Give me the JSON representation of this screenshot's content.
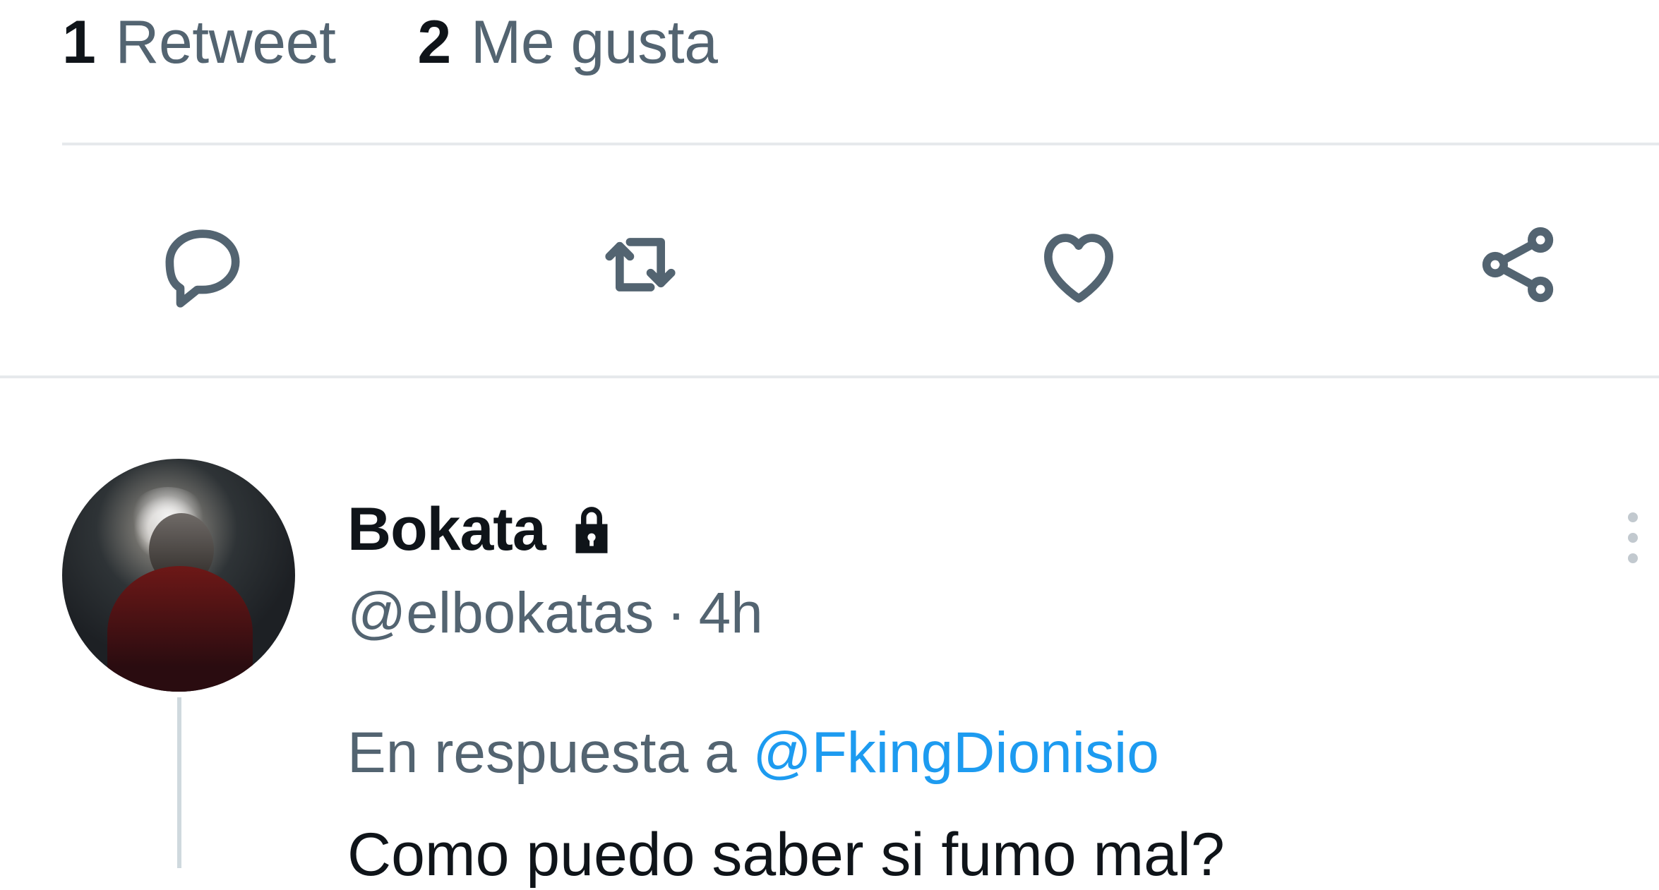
{
  "stats": {
    "retweets": {
      "count": "1",
      "label": "Retweet"
    },
    "likes": {
      "count": "2",
      "label": "Me gusta"
    }
  },
  "actions": [
    {
      "name": "reply",
      "icon": "reply-icon"
    },
    {
      "name": "retweet",
      "icon": "retweet-icon"
    },
    {
      "name": "like",
      "icon": "heart-icon"
    },
    {
      "name": "share",
      "icon": "share-icon"
    }
  ],
  "reply_tweet": {
    "display_name": "Bokata",
    "handle": "@elbokatas",
    "separator": "·",
    "time": "4h",
    "in_reply_to_prefix": "En respuesta a",
    "in_reply_to_handle": "@FkingDionisio",
    "text": "Como puedo saber si fumo mal?",
    "protected_icon": "lock-icon",
    "more_icon": "more-icon"
  },
  "colors": {
    "text_primary": "#0f1419",
    "text_secondary": "#536471",
    "link": "#1d9bf0",
    "divider": "#e6e9ec"
  }
}
